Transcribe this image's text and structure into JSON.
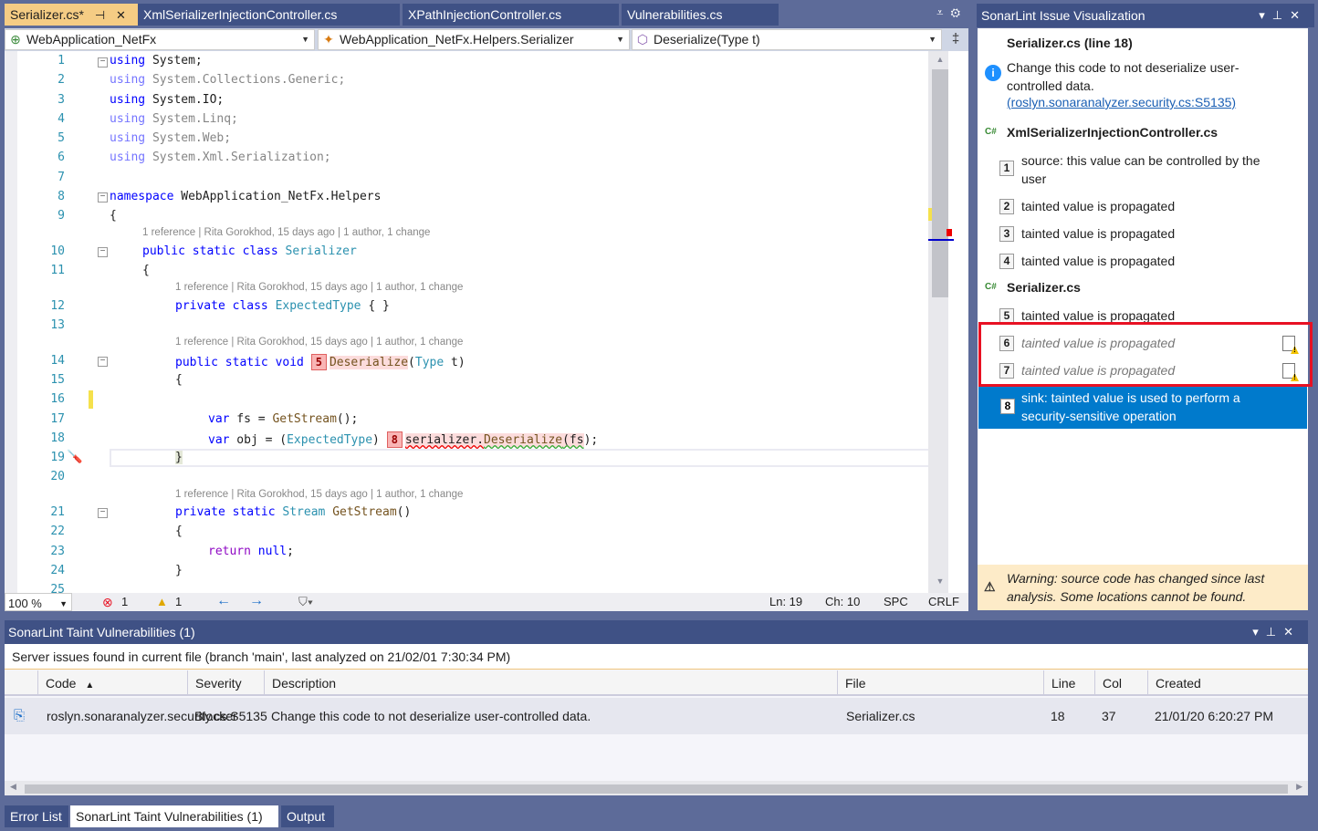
{
  "editor_tabs": [
    {
      "label": "Serializer.cs*",
      "active": true
    },
    {
      "label": "XmlSerializerInjectionController.cs",
      "active": false
    },
    {
      "label": "XPathInjectionController.cs",
      "active": false
    },
    {
      "label": "Vulnerabilities.cs",
      "active": false
    }
  ],
  "navbar": {
    "project": "WebApplication_NetFx",
    "type": "WebApplication_NetFx.Helpers.Serializer",
    "member": "Deserialize(Type t)"
  },
  "code_lens": "1 reference | Rita Gorokhod, 15 days ago | 1 author, 1 change",
  "line_numbers": [
    "1",
    "2",
    "3",
    "4",
    "5",
    "6",
    "7",
    "8",
    "9",
    "10",
    "11",
    "12",
    "13",
    "14",
    "15",
    "16",
    "17",
    "18",
    "19",
    "20",
    "21",
    "22",
    "23",
    "24",
    "25"
  ],
  "code": {
    "l1": [
      "using",
      " System;"
    ],
    "l2": [
      "using",
      " System.Collections.Generic;"
    ],
    "l3": [
      "using",
      " System.IO;"
    ],
    "l4": [
      "using",
      " System.Linq;"
    ],
    "l5": [
      "using",
      " System.Web;"
    ],
    "l6": [
      "using",
      " System.Xml.Serialization;"
    ],
    "l8": [
      "namespace",
      " WebApplication_NetFx.Helpers"
    ],
    "l9": "{",
    "l10": [
      "public static class",
      " ",
      "Serializer"
    ],
    "l11": "{",
    "l12": [
      "private class",
      " ",
      "ExpectedType",
      " { }"
    ],
    "l14": [
      "public static void",
      "5",
      "Deserialize",
      "(",
      "Type",
      " t)"
    ],
    "l15": "{",
    "l17": [
      "var",
      " fs = ",
      "GetStream",
      "();"
    ],
    "l18": [
      "var",
      " obj = (",
      "ExpectedType",
      ")",
      "8",
      "serializer.",
      "Deserialize",
      "(fs",
      ");"
    ],
    "l19": "}",
    "l21": [
      "private static",
      " ",
      "Stream",
      " ",
      "GetStream",
      "()"
    ],
    "l22": "{",
    "l23": [
      "return",
      " ",
      "null",
      ";"
    ],
    "l24": "}"
  },
  "editor_status": {
    "zoom": "100 %",
    "errors": "1",
    "warnings": "1",
    "line": "Ln: 19",
    "char": "Ch: 10",
    "spaces": "SPC",
    "eol": "CRLF"
  },
  "issue_viz": {
    "title": "SonarLint Issue Visualization",
    "header": "Serializer.cs (line 18)",
    "message": "Change this code to not deserialize user-controlled data.",
    "rule_link": "(roslyn.sonaranalyzer.security.cs:S5135)",
    "files": [
      {
        "name": "XmlSerializerInjectionController.cs",
        "lang": "C#",
        "steps": [
          {
            "num": "1",
            "text": "source: this value can be controlled by the user",
            "missing": false
          },
          {
            "num": "2",
            "text": "tainted value is propagated",
            "missing": false
          },
          {
            "num": "3",
            "text": "tainted value is propagated",
            "missing": false
          },
          {
            "num": "4",
            "text": "tainted value is propagated",
            "missing": false
          }
        ]
      },
      {
        "name": "Serializer.cs",
        "lang": "C#",
        "steps": [
          {
            "num": "5",
            "text": "tainted value is propagated",
            "missing": false
          },
          {
            "num": "6",
            "text": "tainted value is propagated",
            "missing": true
          },
          {
            "num": "7",
            "text": "tainted value is propagated",
            "missing": true
          },
          {
            "num": "8",
            "text": "sink: tainted value is used to perform a security-sensitive operation",
            "missing": false,
            "selected": true
          }
        ]
      }
    ],
    "warning": "Warning: source code has changed since last analysis. Some locations cannot be found."
  },
  "taint_window": {
    "title": "SonarLint Taint Vulnerabilities (1)",
    "info": "Server issues found in current file (branch 'main', last analyzed on 21/02/01 7:30:34 PM)",
    "columns": [
      "Code",
      "Severity",
      "Description",
      "File",
      "Line",
      "Col",
      "Created"
    ],
    "rows": [
      {
        "code": "roslyn.sonaranalyzer.security.cs:S5135",
        "severity": "Blocker",
        "description": "Change this code to not deserialize user-controlled data.",
        "file": "Serializer.cs",
        "line": "18",
        "col": "37",
        "created": "21/01/20 6:20:27 PM"
      }
    ]
  },
  "bottom_tabs": [
    {
      "label": "Error List",
      "active": false
    },
    {
      "label": "SonarLint Taint Vulnerabilities (1)",
      "active": true
    },
    {
      "label": "Output",
      "active": false
    }
  ],
  "colors": {
    "accent": "#007acc",
    "tab_active": "#f5cc84",
    "chrome": "#3f5185",
    "highlight_box": "#e81123"
  }
}
